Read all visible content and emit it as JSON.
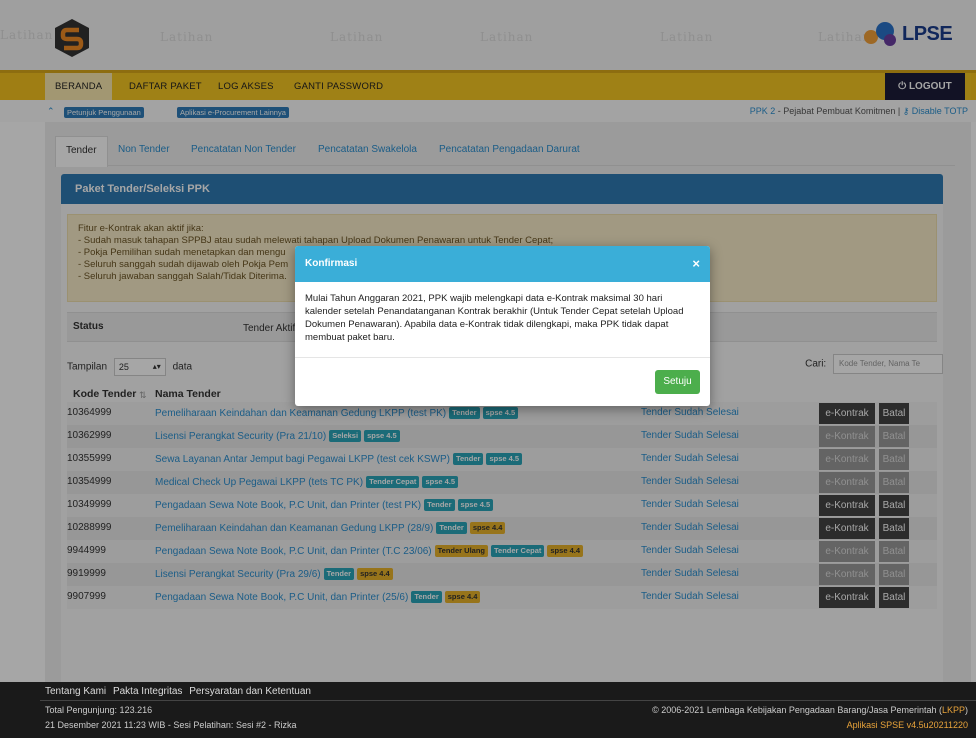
{
  "header": {
    "watermark": "Latihan",
    "logo_text": "LPSE"
  },
  "nav": {
    "items": [
      {
        "label": "BERANDA"
      },
      {
        "label": "DAFTAR PAKET"
      },
      {
        "label": "LOG AKSES"
      },
      {
        "label": "GANTI PASSWORD"
      }
    ],
    "logout_label": "LOGOUT"
  },
  "subbar": {
    "chip1": "Petunjuk Penggunaan",
    "chip2": "Aplikasi e-Procurement Lainnya",
    "user_role": "PPK 2",
    "user_desc": " - Pejabat Pembuat Komitmen | ",
    "totp_link": "Disable TOTP"
  },
  "tabs": [
    {
      "label": "Tender"
    },
    {
      "label": "Non Tender"
    },
    {
      "label": "Pencatatan Non Tender"
    },
    {
      "label": "Pencatatan Swakelola"
    },
    {
      "label": "Pencatatan Pengadaan Darurat"
    }
  ],
  "box_title": "Paket Tender/Seleksi PPK",
  "notice": {
    "line0": "Fitur e-Kontrak akan aktif jika:",
    "line1": "- Sudah masuk tahapan SPPBJ atau sudah melewati tahapan Upload Dokumen Penawaran untuk Tender Cepat;",
    "line2": "- Pokja Pemilihan sudah menetapkan dan mengu",
    "line3": "- Seluruh sanggah sudah dijawab oleh Pokja Pem",
    "line4": "- Seluruh jawaban sanggah Salah/Tidak Diterima."
  },
  "status": {
    "label": "Status",
    "option": "Tender Aktif"
  },
  "table_controls": {
    "show_label": "Tampilan",
    "show_value": "25",
    "data_label": "data",
    "search_label": "Cari:",
    "search_placeholder": "Kode Tender, Nama Te"
  },
  "table": {
    "col_code": "Kode Tender",
    "col_name": "Nama Tender",
    "kontrak_label": "e-Kontrak",
    "batal_label": "Batal",
    "rows": [
      {
        "code": "10364999",
        "name": "Pemeliharaan Keindahan dan Keamanan Gedung LKPP (test PK)",
        "badges": [
          {
            "text": "Tender",
            "color": "teal"
          },
          {
            "text": "spse 4.5",
            "color": "teal"
          }
        ],
        "status": "Tender Sudah Selesai",
        "active": true
      },
      {
        "code": "10362999",
        "name": "Lisensi Perangkat Security (Pra 21/10)",
        "badges": [
          {
            "text": "Seleksi",
            "color": "teal"
          },
          {
            "text": "spse 4.5",
            "color": "teal"
          }
        ],
        "status": "Tender Sudah Selesai",
        "active": false
      },
      {
        "code": "10355999",
        "name": "Sewa Layanan Antar Jemput bagi Pegawai LKPP (test cek KSWP)",
        "badges": [
          {
            "text": "Tender",
            "color": "teal"
          },
          {
            "text": "spse 4.5",
            "color": "teal"
          }
        ],
        "status": "Tender Sudah Selesai",
        "active": false
      },
      {
        "code": "10354999",
        "name": "Medical Check Up Pegawai LKPP (tets TC PK)",
        "badges": [
          {
            "text": "Tender Cepat",
            "color": "teal"
          },
          {
            "text": "spse 4.5",
            "color": "teal"
          }
        ],
        "status": "Tender Sudah Selesai",
        "active": false
      },
      {
        "code": "10349999",
        "name": "Pengadaan Sewa Note Book, P.C Unit, dan Printer (test PK)",
        "badges": [
          {
            "text": "Tender",
            "color": "teal"
          },
          {
            "text": "spse 4.5",
            "color": "teal"
          }
        ],
        "status": "Tender Sudah Selesai",
        "active": true
      },
      {
        "code": "10288999",
        "name": "Pemeliharaan Keindahan dan Keamanan Gedung LKPP (28/9)",
        "badges": [
          {
            "text": "Tender",
            "color": "teal"
          },
          {
            "text": "spse 4.4",
            "color": "yellow"
          }
        ],
        "status": "Tender Sudah Selesai",
        "active": true
      },
      {
        "code": "9944999",
        "name": "Pengadaan Sewa Note Book, P.C Unit, dan Printer (T.C 23/06)",
        "badges": [
          {
            "text": "Tender Ulang",
            "color": "yellow"
          },
          {
            "text": "Tender Cepat",
            "color": "teal"
          },
          {
            "text": "spse 4.4",
            "color": "yellow"
          }
        ],
        "status": "Tender Sudah Selesai",
        "active": false
      },
      {
        "code": "9919999",
        "name": "Lisensi Perangkat Security (Pra 29/6)",
        "badges": [
          {
            "text": "Tender",
            "color": "teal"
          },
          {
            "text": "spse 4.4",
            "color": "yellow"
          }
        ],
        "status": "Tender Sudah Selesai",
        "active": false
      },
      {
        "code": "9907999",
        "name": "Pengadaan Sewa Note Book, P.C Unit, dan Printer (25/6)",
        "badges": [
          {
            "text": "Tender",
            "color": "teal"
          },
          {
            "text": "spse 4.4",
            "color": "yellow"
          }
        ],
        "status": "Tender Sudah Selesai",
        "active": true
      }
    ]
  },
  "modal": {
    "title": "Konfirmasi",
    "body": "Mulai Tahun Anggaran 2021, PPK wajib melengkapi data e-Kontrak maksimal 30 hari kalender setelah Penandatanganan Kontrak berakhir (Untuk Tender Cepat setelah Upload Dokumen Penawaran). Apabila data e-Kontrak tidak dilengkapi, maka PPK tidak dapat membuat paket baru.",
    "button": "Setuju"
  },
  "footer": {
    "link1": "Tentang Kami",
    "link2": "Pakta Integritas",
    "link3": "Persyaratan dan Ketentuan",
    "visitors": "Total Pengunjung: 123.216",
    "session": "21 Desember 2021 11:23 WIB - Sesi Pelatihan: Sesi #2 - Rizka",
    "copyright": "© 2006-2021 Lembaga Kebijakan Pengadaan Barang/Jasa Pemerintah (",
    "copyright_abbr": "LKPP",
    "copyright_end": ")",
    "version": "Aplikasi SPSE v4.5u20211220"
  },
  "colors": {
    "nav_yellow": "#f4c220",
    "box_blue": "#2e7ab2",
    "modal_head": "#3aaed8",
    "ok_green": "#4cae4c"
  }
}
